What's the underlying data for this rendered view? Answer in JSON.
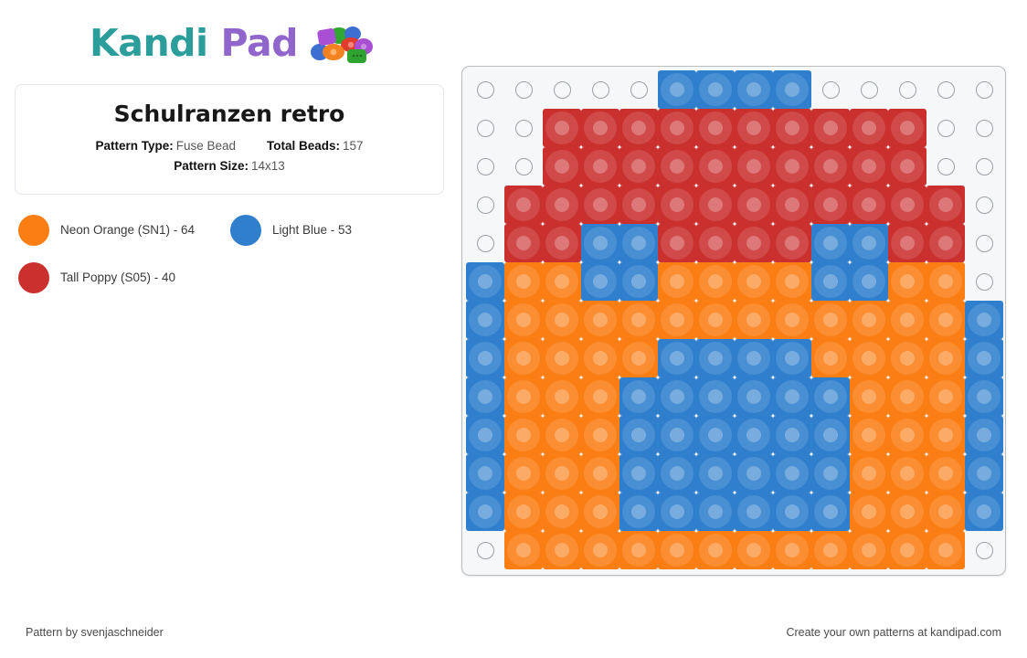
{
  "brand": {
    "word1": "Kandi",
    "word2": "Pad",
    "logo_icon": "kandi-beads-cluster-icon",
    "color_teal": "#2b9e9b",
    "color_purple": "#9166cc"
  },
  "info_card": {
    "title": "Schulranzen retro",
    "pattern_type_label": "Pattern Type:",
    "pattern_type_value": "Fuse Bead",
    "total_beads_label": "Total Beads:",
    "total_beads_value": "157",
    "pattern_size_label": "Pattern Size:",
    "pattern_size_value": "14x13"
  },
  "legend": [
    {
      "label": "Neon Orange (SN1) - 64",
      "color": "#fb7e14",
      "key": "O"
    },
    {
      "label": "Light Blue - 53",
      "color": "#2f7fcd",
      "key": "B"
    },
    {
      "label": "Tall Poppy (S05) - 40",
      "color": "#c9302e",
      "key": "R"
    }
  ],
  "palette": {
    "O": "#fb7e14",
    "B": "#2f7fcd",
    "R": "#c9302e",
    "empty": "#f6f7f8"
  },
  "pattern": {
    "columns": 14,
    "rows": 13,
    "legend_keys": {
      "O": "Neon Orange (SN1)",
      "B": "Light Blue",
      "R": "Tall Poppy (S05)",
      ".": "empty peg"
    },
    "grid": [
      ".....BBBB.....",
      "..RRRRRRRRRR..",
      "..RRRRRRRRRR..",
      ".RRRRRRRRRRRR.",
      ".RRBBRRRRBBRR.",
      "BOOBBOOOOBBOO.",
      "BOOOOOOOOOOOOB",
      "BOOOOBBBBOOOOB",
      "BOOOBBBBBBOOOB",
      "BOOOBBBBBBOOOB",
      "BOOOBBBBBBOOOB",
      "BOOOBBBBBBOOOB",
      ".OOOOOOOOOOOO."
    ],
    "counts": {
      "O": 64,
      "B": 53,
      "R": 40,
      "total": 157
    }
  },
  "footer": {
    "left": "Pattern by svenjaschneider",
    "right": "Create your own patterns at kandipad.com"
  }
}
